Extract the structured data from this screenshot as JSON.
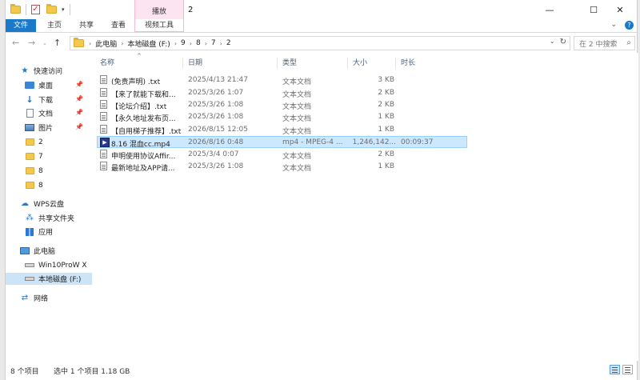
{
  "window": {
    "title": "2",
    "contextual_tab_group": "播放"
  },
  "ribbon": {
    "tabs": [
      "文件",
      "主页",
      "共享",
      "查看",
      "视频工具"
    ]
  },
  "address": {
    "crumbs": [
      "此电脑",
      "本地磁盘 (F:)",
      "9",
      "8",
      "7",
      "2"
    ],
    "search_placeholder": "在 2 中搜索"
  },
  "sidebar": {
    "quick_access": "快速访问",
    "items": [
      {
        "label": "桌面",
        "icon": "desktop-icon",
        "pinned": true
      },
      {
        "label": "下载",
        "icon": "download-icon",
        "pinned": true
      },
      {
        "label": "文档",
        "icon": "document-icon",
        "pinned": true
      },
      {
        "label": "图片",
        "icon": "picture-icon",
        "pinned": true
      },
      {
        "label": "2",
        "icon": "folder-icon"
      },
      {
        "label": "7",
        "icon": "folder-icon"
      },
      {
        "label": "8",
        "icon": "folder-icon"
      },
      {
        "label": "8",
        "icon": "folder-icon"
      }
    ],
    "wps_cloud": "WPS云盘",
    "shared_folder": "共享文件夹",
    "apps": "应用",
    "this_pc": "此电脑",
    "drives": [
      "Win10ProW X",
      "本地磁盘 (F:)"
    ],
    "network": "网络"
  },
  "columns": {
    "name": "名称",
    "date": "日期",
    "type": "类型",
    "size": "大小",
    "duration": "时长"
  },
  "files": [
    {
      "name": "(免责声明) .txt",
      "date": "2025/4/13 21:47",
      "type": "文本文档",
      "size": "3 KB",
      "duration": ""
    },
    {
      "name": "【来了就能下载和...",
      "date": "2025/3/26 1:07",
      "type": "文本文档",
      "size": "2 KB",
      "duration": ""
    },
    {
      "name": "【论坛介绍】.txt",
      "date": "2025/3/26 1:08",
      "type": "文本文档",
      "size": "2 KB",
      "duration": ""
    },
    {
      "name": "【永久地址发布页...",
      "date": "2025/3/26 1:08",
      "type": "文本文档",
      "size": "1 KB",
      "duration": ""
    },
    {
      "name": "【自用梯子推荐】.txt",
      "date": "2026/8/15 12:05",
      "type": "文本文档",
      "size": "1 KB",
      "duration": ""
    },
    {
      "name": "8.16 混血cc.mp4",
      "date": "2026/8/16 0:48",
      "type": "mp4 - MPEG-4 ...",
      "size": "1,246,142...",
      "duration": "00:09:37"
    },
    {
      "name": "申明使用协议Affir...",
      "date": "2025/3/4 0:07",
      "type": "文本文档",
      "size": "2 KB",
      "duration": ""
    },
    {
      "name": "最新地址及APP请...",
      "date": "2025/3/26 1:08",
      "type": "文本文档",
      "size": "1 KB",
      "duration": ""
    }
  ],
  "status": {
    "count": "8 个项目",
    "selection": "选中 1 个项目  1.18 GB"
  }
}
